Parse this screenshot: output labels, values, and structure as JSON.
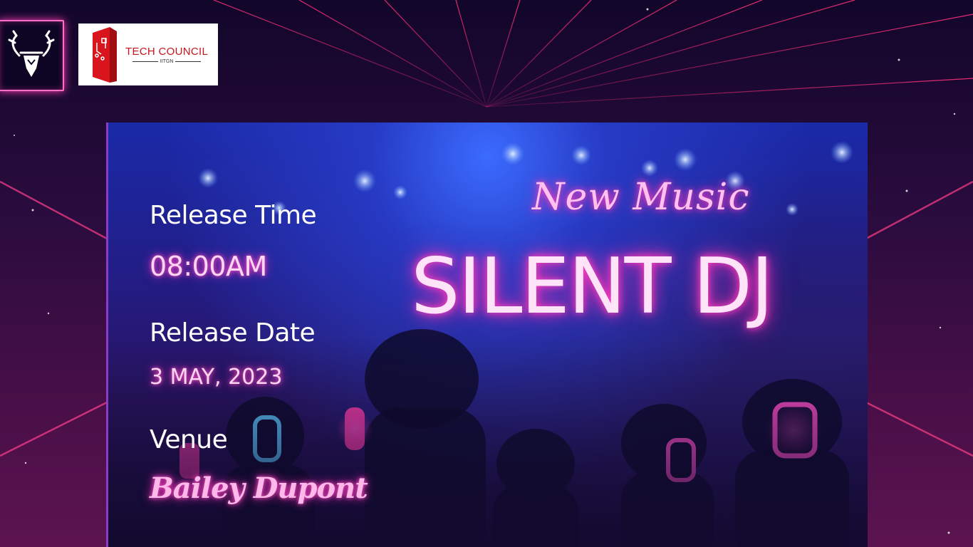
{
  "header": {
    "brand_logo": {
      "icon": "deer-head-logo-icon"
    },
    "partner_logo": {
      "title": "TECH COUNCIL",
      "subtitle": "IITGN",
      "icon": "tech-council-building-icon"
    }
  },
  "poster": {
    "tagline": "New Music",
    "title": "SILENT DJ",
    "info": [
      {
        "label": "Release Time",
        "value": "08:00AM"
      },
      {
        "label": "Release Date",
        "value": "3 MAY, 2023"
      },
      {
        "label": "Venue",
        "value": "Bailey Dupont"
      }
    ]
  },
  "colors": {
    "background": "#1a0a2e",
    "neon_pink": "#ff3fb4",
    "grid_line": "#ff2f7a",
    "poster_blue": "#2a3cc8",
    "brand_red": "#c8141c"
  }
}
